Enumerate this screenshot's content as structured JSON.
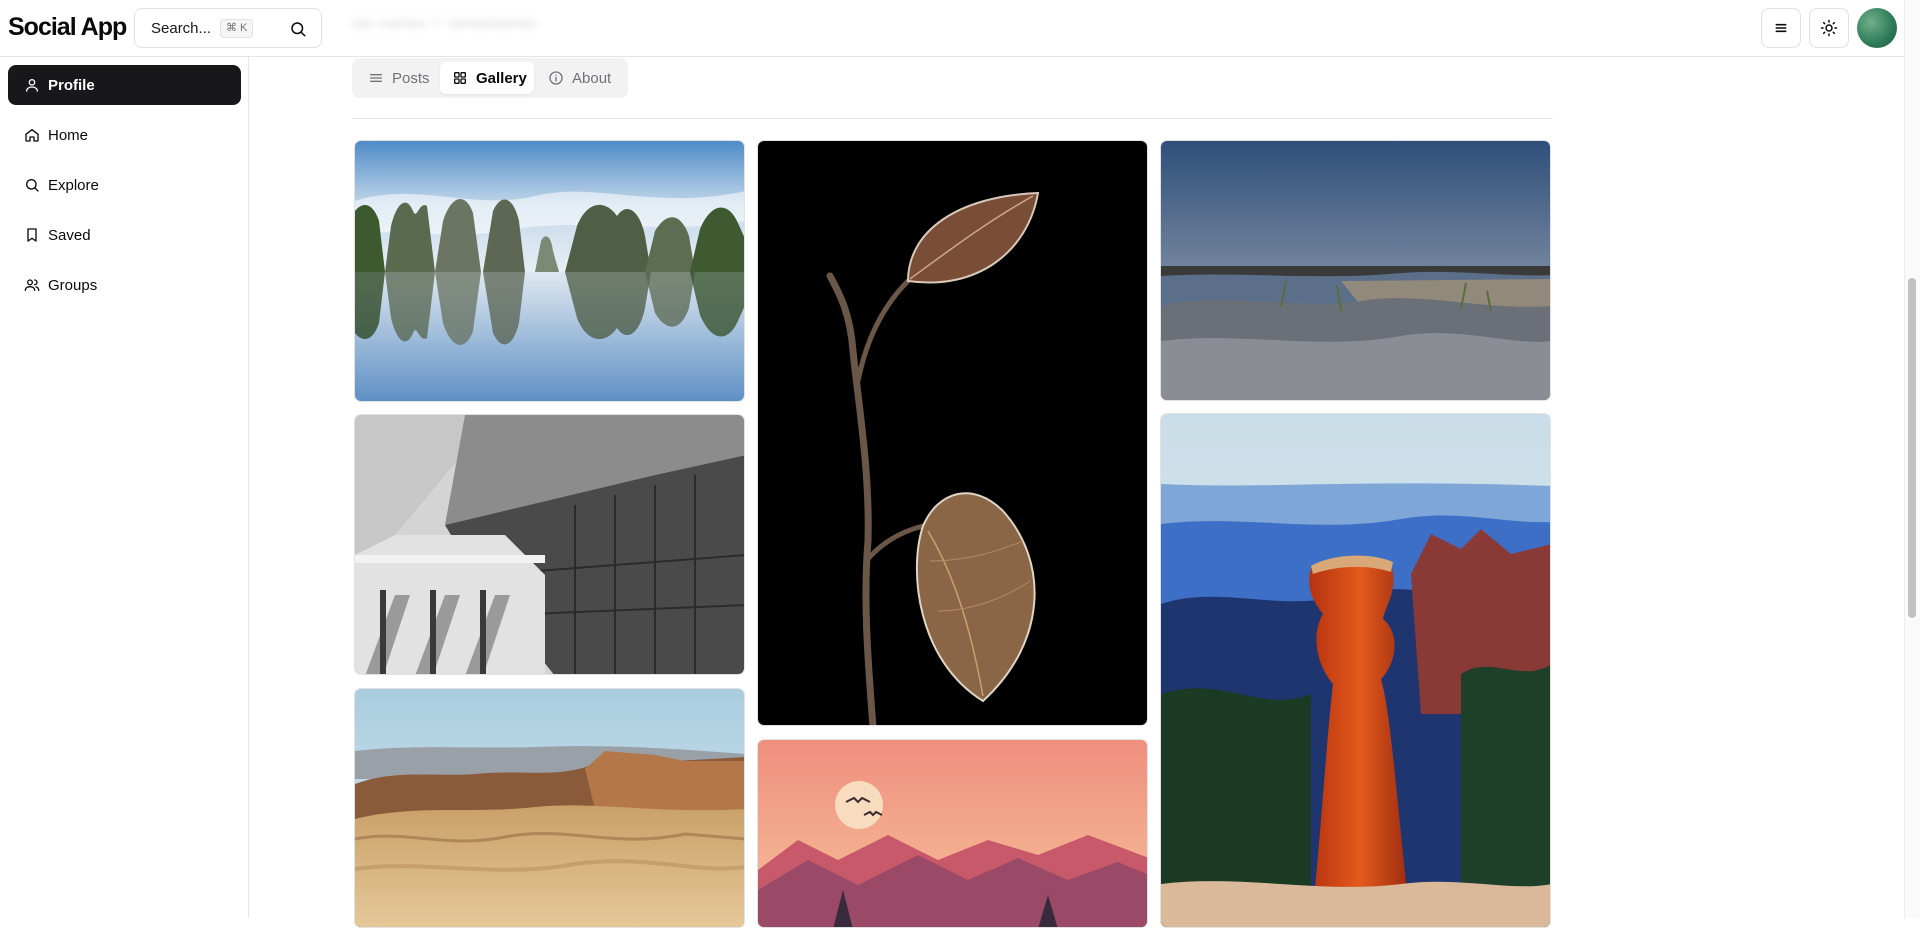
{
  "app": {
    "name": "Social App"
  },
  "search": {
    "label": "Search...",
    "shortcut": "⌘ K"
  },
  "header": {
    "blurred_title": "— —— · ————"
  },
  "sidebar": {
    "items": [
      {
        "label": "Profile",
        "icon": "user-icon",
        "active": true
      },
      {
        "label": "Home",
        "icon": "home-icon",
        "active": false
      },
      {
        "label": "Explore",
        "icon": "search-icon",
        "active": false
      },
      {
        "label": "Saved",
        "icon": "bookmark-icon",
        "active": false
      },
      {
        "label": "Groups",
        "icon": "users-icon",
        "active": false
      }
    ]
  },
  "tabs": [
    {
      "label": "Posts",
      "icon": "list-icon",
      "active": false
    },
    {
      "label": "Gallery",
      "icon": "grid-icon",
      "active": true
    },
    {
      "label": "About",
      "icon": "info-icon",
      "active": false
    }
  ],
  "gallery": {
    "photos": [
      {
        "subject": "karst-peaks-reflection"
      },
      {
        "subject": "modern-building-bw"
      },
      {
        "subject": "desert-ridges"
      },
      {
        "subject": "frosted-leaves-on-black"
      },
      {
        "subject": "sunset-mountains-illustration"
      },
      {
        "subject": "lake-at-dusk"
      },
      {
        "subject": "hoodoo-canyon"
      }
    ]
  },
  "colors": {
    "accent": "#18181b",
    "border": "#e5e5e5",
    "muted": "#71717a"
  }
}
